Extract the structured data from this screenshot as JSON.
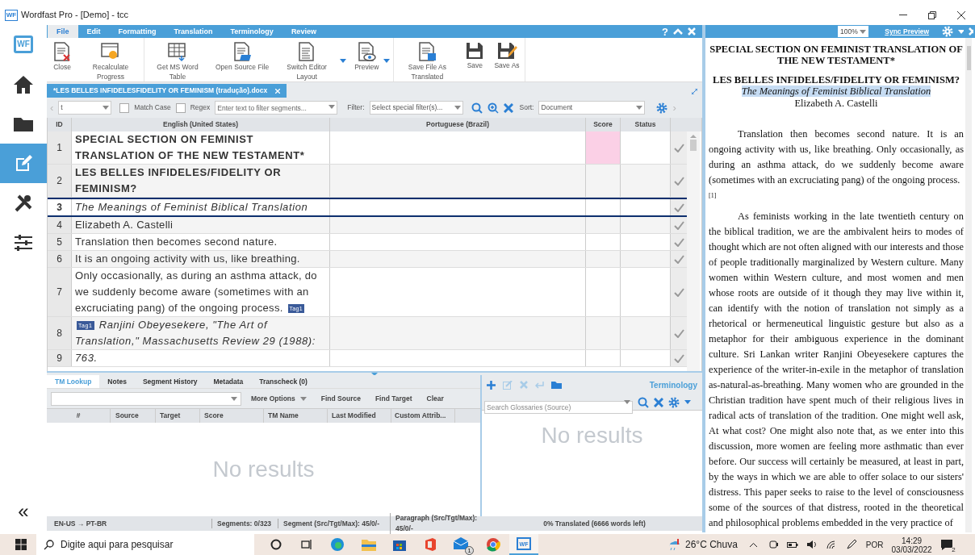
{
  "window": {
    "title": "Wordfast Pro - [Demo] - tcc",
    "logo": "WF"
  },
  "sidebar": {
    "logo": "WF",
    "items": [
      {
        "kind": "home",
        "selected": false
      },
      {
        "kind": "folder",
        "selected": false
      },
      {
        "kind": "edit",
        "selected": true
      },
      {
        "kind": "tools",
        "selected": false
      },
      {
        "kind": "sliders",
        "selected": false
      }
    ],
    "collapse": "«"
  },
  "ribbon_tabs": [
    {
      "label": "File",
      "selected": true
    },
    {
      "label": "Edit",
      "selected": false
    },
    {
      "label": "Formatting",
      "selected": false
    },
    {
      "label": "Translation",
      "selected": false
    },
    {
      "label": "Terminology",
      "selected": false
    },
    {
      "label": "Review",
      "selected": false
    }
  ],
  "help": "?",
  "ribbon_buttons": [
    {
      "kind": "close",
      "label": "Close",
      "dropdown": false,
      "group_end": false
    },
    {
      "kind": "recalc",
      "label": "Recalculate Progress",
      "dropdown": false,
      "group_end": true
    },
    {
      "kind": "table",
      "label": "Get MS Word Table",
      "dropdown": false,
      "group_end": false
    },
    {
      "kind": "open",
      "label": "Open Source File",
      "dropdown": false,
      "group_end": false
    },
    {
      "kind": "layout",
      "label": "Switch Editor Layout",
      "dropdown": true,
      "group_end": false
    },
    {
      "kind": "preview",
      "label": "Preview",
      "dropdown": true,
      "group_end": true
    },
    {
      "kind": "savetrans",
      "label": "Save File As Translated",
      "dropdown": false,
      "group_end": false
    },
    {
      "kind": "save",
      "label": "Save",
      "dropdown": false,
      "group_end": false
    },
    {
      "kind": "saveas",
      "label": "Save As",
      "dropdown": false,
      "group_end": true
    }
  ],
  "document_tab": {
    "label": "*LES BELLES INFIDELESFIDELITY OR FEMINISM (tradução).docx"
  },
  "filter_bar": {
    "previous": "‹",
    "next": "›",
    "search_value": "t",
    "match_case": {
      "label": "Match Case",
      "checked": false
    },
    "regex": {
      "label": "Regex",
      "checked": false
    },
    "filter_placeholder": "Enter text to filter segments...",
    "filter_label": "Filter:",
    "special_filter": "Select special filter(s)...",
    "sort_label": "Sort:",
    "sort_value": "Document"
  },
  "grid": {
    "columns": [
      "ID",
      "English (United States)",
      "Portuguese (Brazil)",
      "Score",
      "Status"
    ]
  },
  "segments": [
    {
      "id": "1",
      "source": "SPECIAL SECTION ON FEMINIST TRANSLATION OF THE NEW TESTAMENT*",
      "kind": "heading",
      "selected": false,
      "score_highlighted": true
    },
    {
      "id": "2",
      "source": "LES BELLES INFIDELES/FIDELITY OR FEMINISM?",
      "kind": "heading",
      "selected": false,
      "score_highlighted": false
    },
    {
      "id": "3",
      "source": "The Meanings of Feminist Biblical Translation",
      "kind": "italic",
      "selected": true,
      "score_highlighted": false
    },
    {
      "id": "4",
      "source": "Elizabeth A. Castelli",
      "kind": "plain",
      "selected": false,
      "score_highlighted": false
    },
    {
      "id": "5",
      "source": "Translation then becomes second nature.",
      "kind": "plain",
      "selected": false,
      "score_highlighted": false
    },
    {
      "id": "6",
      "source": "It is an ongoing activity with us, like breathing.",
      "kind": "plain",
      "selected": false,
      "score_highlighted": false
    },
    {
      "id": "7",
      "source": "Only occasionally, as during an asthma attack, do we suddenly become aware (sometimes with an excruciating pang) of the ongoing process.",
      "kind": "plain",
      "selected": false,
      "score_highlighted": false,
      "tag_after": "Tag1"
    },
    {
      "id": "8",
      "source": "Ranjini Obeyesekere, \"The Art of Translation,\" Massachusetts Review 29 (1988):",
      "kind": "italic",
      "selected": false,
      "score_highlighted": false,
      "tag_before": "Tag1"
    },
    {
      "id": "9",
      "source": "763.",
      "kind": "italic",
      "selected": false,
      "score_highlighted": false
    }
  ],
  "bottom_tabs": [
    {
      "label": "TM Lookup",
      "selected": true
    },
    {
      "label": "Notes",
      "selected": false
    },
    {
      "label": "Segment History",
      "selected": false
    },
    {
      "label": "Metadata",
      "selected": false
    },
    {
      "label": "Transcheck (0)",
      "selected": false
    }
  ],
  "tm_toolbar": [
    "More Options",
    "Find Source",
    "Find Target",
    "Clear"
  ],
  "tm_columns": [
    "#",
    "Source",
    "Target",
    "Score",
    "TM Name",
    "Last Modified",
    "Custom Attrib..."
  ],
  "tm_empty": "No results",
  "terminology": {
    "title": "Terminology",
    "search_placeholder": "Search Glossaries (Source)",
    "empty": "No results"
  },
  "status_bar": [
    "EN-US → PT-BR",
    "Segments: 0/323",
    "Segment (Src/Tgt/Max): 45/0/-",
    "Paragraph (Src/Tgt/Max): 45/0/-",
    "0% Translated (6666 words left)"
  ],
  "preview": {
    "zoom": "100%",
    "sync": "Sync Preview",
    "heading": "SPECIAL SECTION ON FEMINIST TRANSLATION OF THE NEW TESTAMENT*",
    "title": "LES BELLES INFIDELES/FIDELITY OR FEMINISM?",
    "subtitle": "The Meanings of Feminist Biblical Translation",
    "author": "Elizabeth A. Castelli",
    "paragraphs": [
      "Translation then becomes second nature. It is an ongoing activity with us, like breathing. Only occasionally, as during an asthma attack, do we suddenly become aware (sometimes with an excruciating pang) of the ongoing process.",
      "As feminists working in the late twentieth century on the biblical tradition, we are the ambivalent heirs to modes of thought which are not often aligned with our interests and those of people traditionally marginalized by Western culture. Many women within Western culture, and most women and men whose roots are outside of it though they may live within it, can identify with the notion of translation not simply as a rhetorical or hermeneutical linguistic gesture but also as a metaphor for their ambiguous experience in the dominant culture. Sri Lankan writer Ranjini Obeyesekere captures the experience of the writer-in-exile in the metaphor of translation as-natural-as-breathing. Many women who are grounded in the Christian tradition have spent much of their religious lives in radical acts of translation of the tradition. One might well ask, At what cost? One might also note that, as we enter into this discussion, more women are feeling more asthmatic than ever before. Our success will certainly be measured, at least in part, by the ways in which we are able to offer solace to our sisters' distress. This paper seeks to raise to the level of consciousness some of the sources of that distress, rooted in the theoretical and philosophical problems embedded in the very practice of"
    ],
    "footnote": "[1]"
  },
  "taskbar": {
    "search_placeholder": "Digite aqui para pesquisar",
    "app_logo": "WF",
    "mail_badge": "1",
    "weather": "26°C Chuva",
    "language": "POR",
    "time": "14:29",
    "date": "03/03/2022",
    "notifications": "2"
  }
}
